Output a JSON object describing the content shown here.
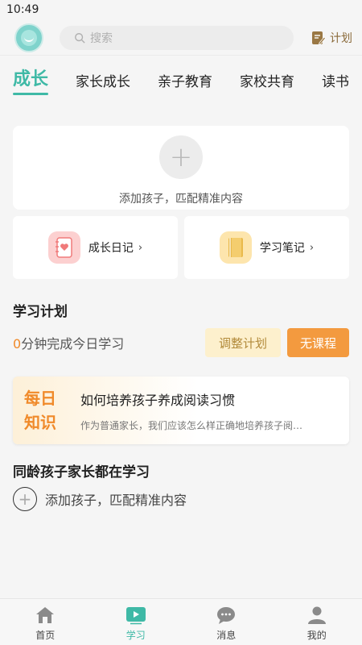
{
  "status_bar": {
    "time": "10:49"
  },
  "header": {
    "search_placeholder": "搜索",
    "plan_label": "计划"
  },
  "tabs": [
    {
      "label": "成长",
      "active": true
    },
    {
      "label": "家长成长",
      "active": false
    },
    {
      "label": "亲子教育",
      "active": false
    },
    {
      "label": "家校共育",
      "active": false
    },
    {
      "label": "读书",
      "active": false
    }
  ],
  "add_child": {
    "label": "添加孩子，匹配精准内容"
  },
  "quick_links": [
    {
      "label": "成长日记",
      "icon": "diary-heart-icon",
      "color": "#fcd0d0"
    },
    {
      "label": "学习笔记",
      "icon": "notebook-icon",
      "color": "#fde5ad"
    }
  ],
  "study_plan": {
    "title": "学习计划",
    "minutes": "0",
    "progress_text": "分钟完成今日学习",
    "adjust_label": "调整计划",
    "no_course_label": "无课程"
  },
  "daily_knowledge": {
    "badge_line1": "每日",
    "badge_line2": "知识",
    "title": "如何培养孩子养成阅读习惯",
    "desc": "作为普通家长，我们应该怎么样正确地培养孩子阅…"
  },
  "peers": {
    "title": "同龄孩子家长都在学习",
    "add_label": "添加孩子，匹配精准内容"
  },
  "bottom_nav": [
    {
      "label": "首页",
      "icon": "home-icon",
      "active": false
    },
    {
      "label": "学习",
      "icon": "play-icon",
      "active": true
    },
    {
      "label": "消息",
      "icon": "chat-icon",
      "active": false
    },
    {
      "label": "我的",
      "icon": "user-icon",
      "active": false
    }
  ],
  "colors": {
    "accent": "#3fb9a6",
    "orange": "#f39a3f"
  }
}
